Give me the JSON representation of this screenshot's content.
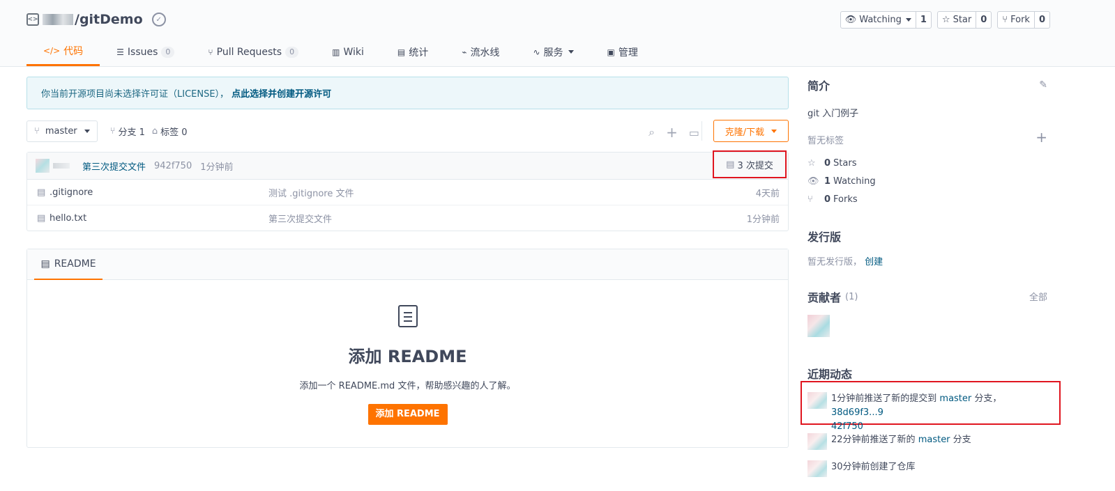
{
  "repo": {
    "name": "/gitDemo",
    "repo_icon": "code-icon",
    "badge_icon": "badge-icon"
  },
  "actions": {
    "watching": {
      "label": "Watching",
      "count": "1"
    },
    "star": {
      "label": "Star",
      "count": "0"
    },
    "fork": {
      "label": "Fork",
      "count": "0"
    }
  },
  "tabs": [
    {
      "label": "代码",
      "icon": "code-icon"
    },
    {
      "label": "Issues",
      "count": "0",
      "icon": "issues-icon"
    },
    {
      "label": "Pull Requests",
      "count": "0",
      "icon": "pull-request-icon"
    },
    {
      "label": "Wiki",
      "icon": "wiki-icon"
    },
    {
      "label": "统计",
      "icon": "chart-icon"
    },
    {
      "label": "流水线",
      "icon": "pipeline-icon"
    },
    {
      "label": "服务",
      "icon": "service-icon"
    },
    {
      "label": "管理",
      "icon": "manage-icon"
    }
  ],
  "license_notice": {
    "text": "你当前开源项目尚未选择许可证（LICENSE），",
    "link": "点此选择并创建开源许可"
  },
  "toolbar": {
    "branch": "master",
    "branches": "分支 1",
    "tags": "标签 0",
    "clone_label": "克隆/下载"
  },
  "commit": {
    "message": "第三次提交文件",
    "sha": "942f750",
    "time": "1分钟前",
    "count_label": "3 次提交"
  },
  "files": [
    {
      "name": ".gitignore",
      "message": "测试 .gitignore 文件",
      "time": "4天前"
    },
    {
      "name": "hello.txt",
      "message": "第三次提交文件",
      "time": "1分钟前"
    }
  ],
  "readme": {
    "tab_label": "README",
    "title": "添加 README",
    "subtitle": "添加一个 README.md 文件，帮助感兴趣的人了解。",
    "button": "添加 README"
  },
  "sidebar": {
    "intro_title": "简介",
    "intro_text": "git 入门例子",
    "no_tags": "暂无标签",
    "stats": [
      {
        "count": "0",
        "label": "Stars",
        "icon": "star-icon"
      },
      {
        "count": "1",
        "label": "Watching",
        "icon": "eye-icon"
      },
      {
        "count": "0",
        "label": "Forks",
        "icon": "fork-icon"
      }
    ],
    "release_title": "发行版",
    "no_release": "暂无发行版，",
    "create_link": "创建",
    "contrib_title": "贡献者",
    "contrib_count": "(1)",
    "all_link": "全部",
    "activity_title": "近期动态",
    "activities": [
      {
        "pre": "1分钟前推送了新的提交到 ",
        "branch": "master",
        "mid": " 分支，",
        "link": "38d69f3...9",
        "link2": "42f750"
      },
      {
        "pre": "22分钟前推送了新的 ",
        "branch": "master",
        "mid": " 分支"
      },
      {
        "pre": "30分钟前创建了仓库"
      }
    ]
  },
  "colors": {
    "accent": "#fe7300",
    "link": "#005980",
    "highlight": "#e0151f"
  }
}
